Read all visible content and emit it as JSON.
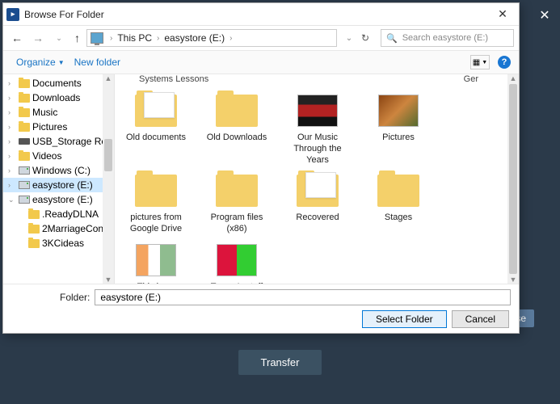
{
  "bg": {
    "transfer": "Transfer",
    "se": "se"
  },
  "dialog": {
    "title": "Browse For Folder",
    "breadcrumb": {
      "root": "This PC",
      "current": "easystore (E:)"
    },
    "search_placeholder": "Search easystore (E:)",
    "toolbar": {
      "organize": "Organize",
      "new_folder": "New folder"
    },
    "folder_label": "Folder:",
    "folder_value": "easystore (E:)",
    "select_btn": "Select Folder",
    "cancel_btn": "Cancel"
  },
  "tree": [
    {
      "label": "Documents",
      "icon": "folder",
      "caret": ">"
    },
    {
      "label": "Downloads",
      "icon": "folder",
      "caret": ">"
    },
    {
      "label": "Music",
      "icon": "folder",
      "caret": ">"
    },
    {
      "label": "Pictures",
      "icon": "folder",
      "caret": ">"
    },
    {
      "label": "USB_Storage Re",
      "icon": "usb",
      "caret": ">"
    },
    {
      "label": "Videos",
      "icon": "folder",
      "caret": ">"
    },
    {
      "label": "Windows (C:)",
      "icon": "drive",
      "caret": ">"
    },
    {
      "label": "easystore (E:)",
      "icon": "drive",
      "caret": ">",
      "selected": true
    },
    {
      "label": "easystore (E:)",
      "icon": "drive",
      "caret": "v",
      "indent": 0
    },
    {
      "label": ".ReadyDLNA",
      "icon": "folder",
      "caret": "",
      "indent": 1
    },
    {
      "label": "2MarriageConfe",
      "icon": "folder",
      "caret": "",
      "indent": 1
    },
    {
      "label": "3KCideas",
      "icon": "folder",
      "caret": "",
      "indent": 1
    }
  ],
  "truncated": {
    "left": "Systems Lessons",
    "right": "Ger"
  },
  "files": [
    {
      "label": "Old documents",
      "thumb": "peek"
    },
    {
      "label": "Old Downloads",
      "thumb": "folder"
    },
    {
      "label": "Our Music Through the Years",
      "thumb": "img2"
    },
    {
      "label": "Pictures",
      "thumb": "img1"
    },
    {
      "label": "pictures from Google Drive",
      "thumb": "folder"
    },
    {
      "label": "Program files (x86)",
      "thumb": "folder"
    },
    {
      "label": "Recovered",
      "thumb": "peek"
    },
    {
      "label": "Stages",
      "thumb": "folder"
    },
    {
      "label": "This is us lessons",
      "thumb": "img4"
    },
    {
      "label": "Tracey's stuff",
      "thumb": "img6"
    }
  ]
}
